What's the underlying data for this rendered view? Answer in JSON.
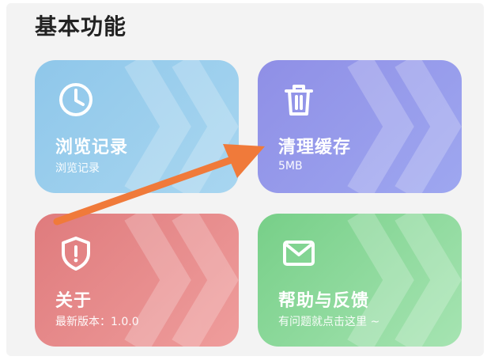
{
  "section": {
    "title": "基本功能"
  },
  "cards": [
    {
      "title": "浏览记录",
      "subtitle": "浏览记录",
      "icon": "clock-icon",
      "color": "#9ccfee"
    },
    {
      "title": "清理缓存",
      "subtitle": "5MB",
      "icon": "trash-icon",
      "color": "#9296ea"
    },
    {
      "title": "关于",
      "subtitle": "最新版本：1.0.0",
      "icon": "shield-alert-icon",
      "color": "#e58586"
    },
    {
      "title": "帮助与反馈",
      "subtitle": "有问题就点击这里 ~",
      "icon": "mail-icon",
      "color": "#89d89a"
    }
  ],
  "annotation": {
    "type": "arrow",
    "color": "#f07a3a",
    "points_to": "清理缓存"
  }
}
